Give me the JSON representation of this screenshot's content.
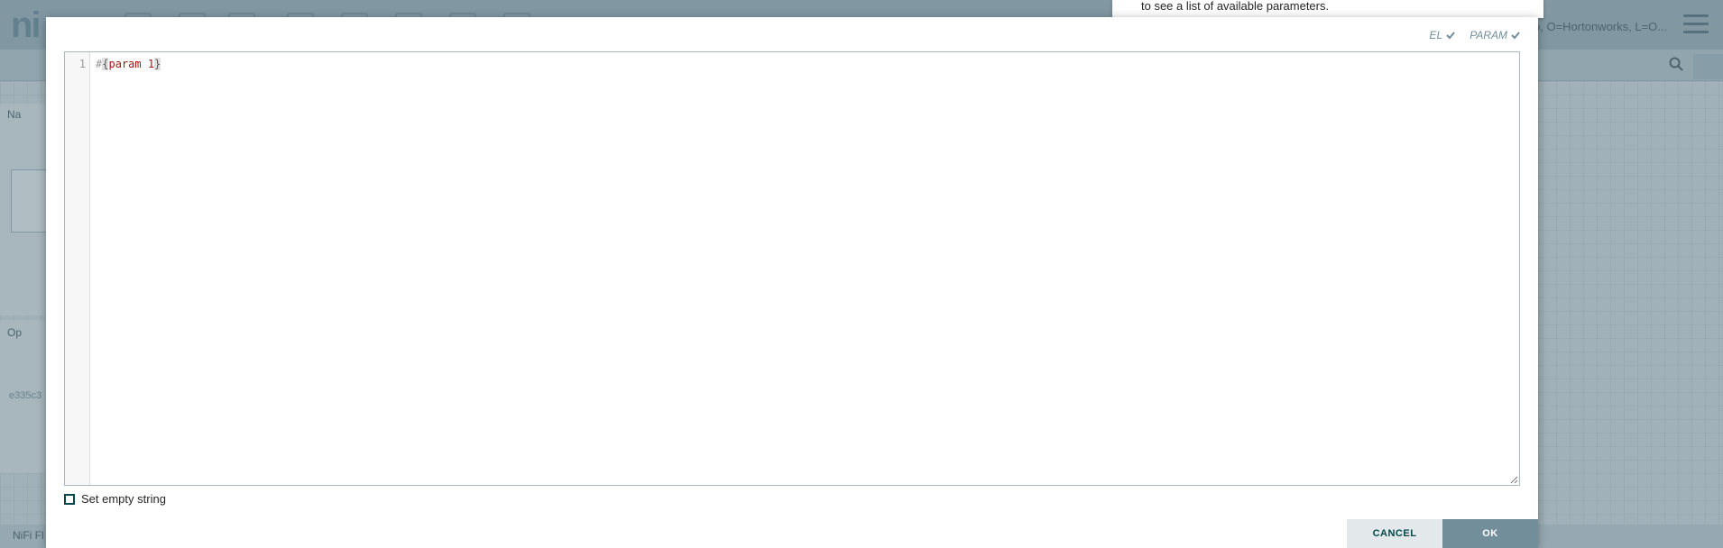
{
  "background": {
    "logo": "ni",
    "user_identity": "o, O=Hortonworks, L=O...",
    "navigation_label": "Na",
    "operate_label": "Op",
    "component_id": "e335c3",
    "footer_text": "NiFi Fl"
  },
  "tooltip": {
    "text": "to see a list of available parameters."
  },
  "dialog": {
    "badges": {
      "el": "EL",
      "param": "PARAM"
    },
    "editor": {
      "line_number": "1",
      "tokens": {
        "hash": "#",
        "open": "{",
        "name": "param 1",
        "close": "}"
      }
    },
    "empty_string_label": "Set empty string",
    "cancel_label": "CANCEL",
    "ok_label": "OK"
  },
  "colors": {
    "accent": "#728e9b",
    "primary_text": "#004849",
    "param_name": "#aa1111"
  }
}
